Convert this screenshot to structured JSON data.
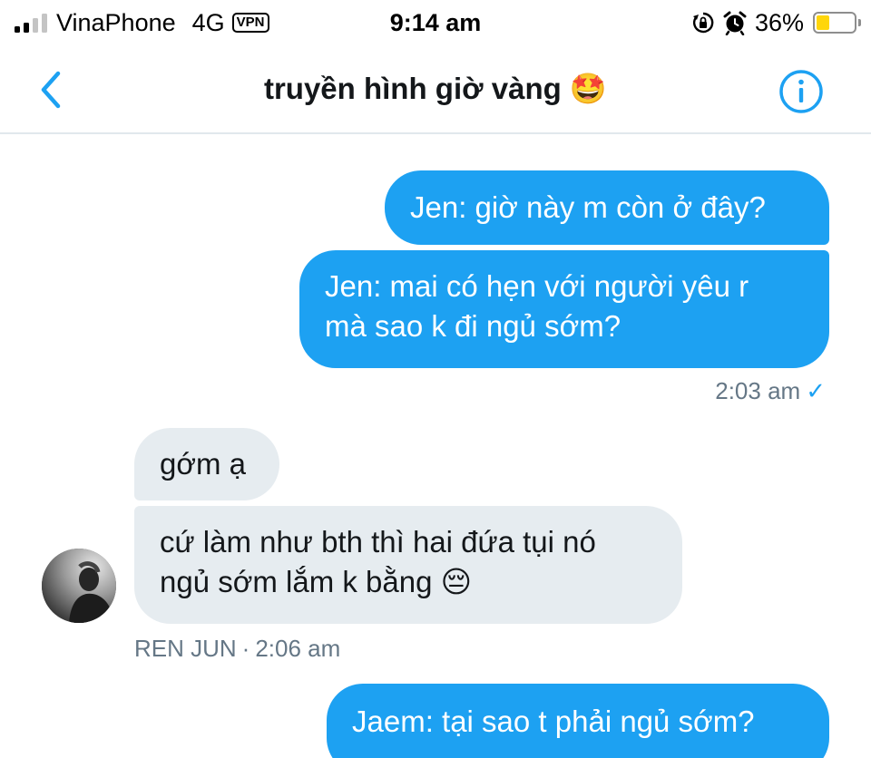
{
  "status_bar": {
    "carrier": "VinaPhone",
    "network": "4G",
    "vpn_label": "VPN",
    "time": "9:14 am",
    "battery_percent": "36%",
    "battery_level": 0.36,
    "signal_bars_active": 2,
    "signal_bars_total": 4,
    "icons": [
      "signal-icon",
      "orientation-lock-icon",
      "alarm-icon",
      "battery-icon"
    ]
  },
  "nav": {
    "title": "truyền hình giờ vàng 🤩",
    "back_icon": "chevron-left-icon",
    "info_icon": "info-icon",
    "accent_color": "#1da1f2"
  },
  "messages": [
    {
      "direction": "outgoing",
      "text": "Jen: giờ này m còn ở đây?"
    },
    {
      "direction": "outgoing",
      "lines": [
        "Jen: mai có hẹn với người yêu r",
        "mà sao k đi ngủ sớm?"
      ]
    },
    {
      "direction": "incoming",
      "text": "gớm ạ"
    },
    {
      "direction": "incoming",
      "lines": [
        "cứ làm như bth thì hai đứa tụi nó",
        "ngủ sớm lắm k bằng 😔"
      ]
    },
    {
      "direction": "outgoing",
      "text": "Jaem: tại sao t phải ngủ sớm?"
    }
  ],
  "meta": {
    "outgoing_time": "2:03 am",
    "read_mark": "✓",
    "sender_name": "REN JUN",
    "separator": "·",
    "incoming_time": "2:06 am"
  },
  "colors": {
    "outgoing_bubble": "#1da1f2",
    "incoming_bubble": "#e6ecf0",
    "meta_text": "#657786"
  }
}
